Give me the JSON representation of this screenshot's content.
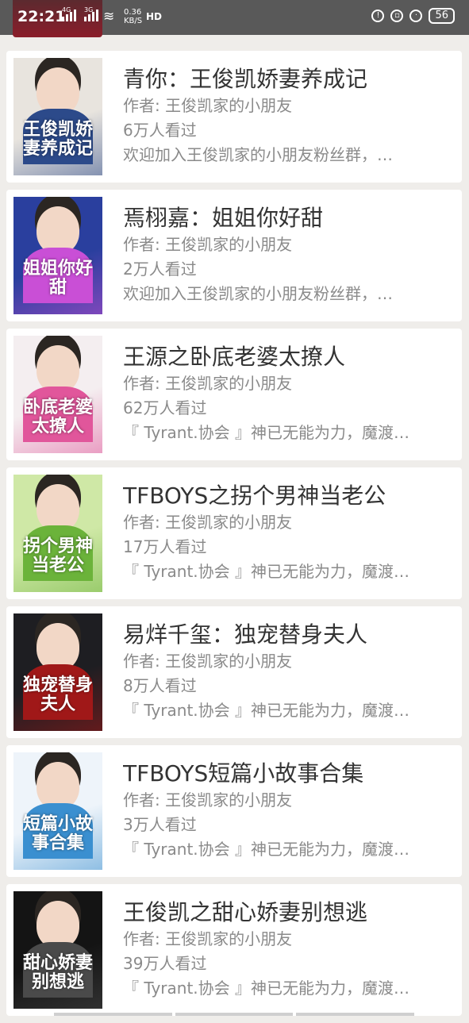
{
  "status_bar": {
    "time": "22:21",
    "signal1": "4G",
    "signal2": "3G",
    "speed_value": "0.36",
    "speed_unit": "KB/S",
    "hd": "HD",
    "battery": "56"
  },
  "books": [
    {
      "title": "青你：王俊凯娇妻养成记",
      "author": "作者: 王俊凯家的小朋友",
      "views": "6万人看过",
      "desc": "欢迎加入王俊凯家的小朋友粉丝群，…",
      "cover_text": "王俊凯娇妻养成记",
      "cover_bg": "#e8e4de",
      "cover_accent": "#2c4a8a"
    },
    {
      "title": "焉栩嘉：姐姐你好甜",
      "author": "作者: 王俊凯家的小朋友",
      "views": "2万人看过",
      "desc": "欢迎加入王俊凯家的小朋友粉丝群，…",
      "cover_text": "姐姐你好甜",
      "cover_bg": "#2a3f9e",
      "cover_accent": "#c94fd6"
    },
    {
      "title": "王源之卧底老婆太撩人",
      "author": "作者: 王俊凯家的小朋友",
      "views": "62万人看过",
      "desc": "『 Tyrant.协会 』神已无能为力，魔渡…",
      "cover_text": "卧底老婆太撩人",
      "cover_bg": "#f4eef0",
      "cover_accent": "#e1569b"
    },
    {
      "title": "TFBOYS之拐个男神当老公",
      "author": "作者: 王俊凯家的小朋友",
      "views": "17万人看过",
      "desc": "『 Tyrant.协会 』神已无能为力，魔渡…",
      "cover_text": "拐个男神当老公",
      "cover_bg": "#cfe8a6",
      "cover_accent": "#6bb33a"
    },
    {
      "title": "易烊千玺：独宠替身夫人",
      "author": "作者: 王俊凯家的小朋友",
      "views": "8万人看过",
      "desc": "『 Tyrant.协会 』神已无能为力，魔渡…",
      "cover_text": "独宠替身夫人",
      "cover_bg": "#1e1e22",
      "cover_accent": "#a01818"
    },
    {
      "title": "TFBOYS短篇小故事合集",
      "author": "作者: 王俊凯家的小朋友",
      "views": "3万人看过",
      "desc": "『 Tyrant.协会 』神已无能为力，魔渡…",
      "cover_text": "短篇小故事合集",
      "cover_bg": "#eef4fa",
      "cover_accent": "#3a8fd0"
    },
    {
      "title": "王俊凯之甜心娇妻别想逃",
      "author": "作者: 王俊凯家的小朋友",
      "views": "39万人看过",
      "desc": "『 Tyrant.协会 』神已无能为力，魔渡…",
      "cover_text": "甜心娇妻别想逃",
      "cover_bg": "#141414",
      "cover_accent": "#4a4a4a"
    }
  ]
}
